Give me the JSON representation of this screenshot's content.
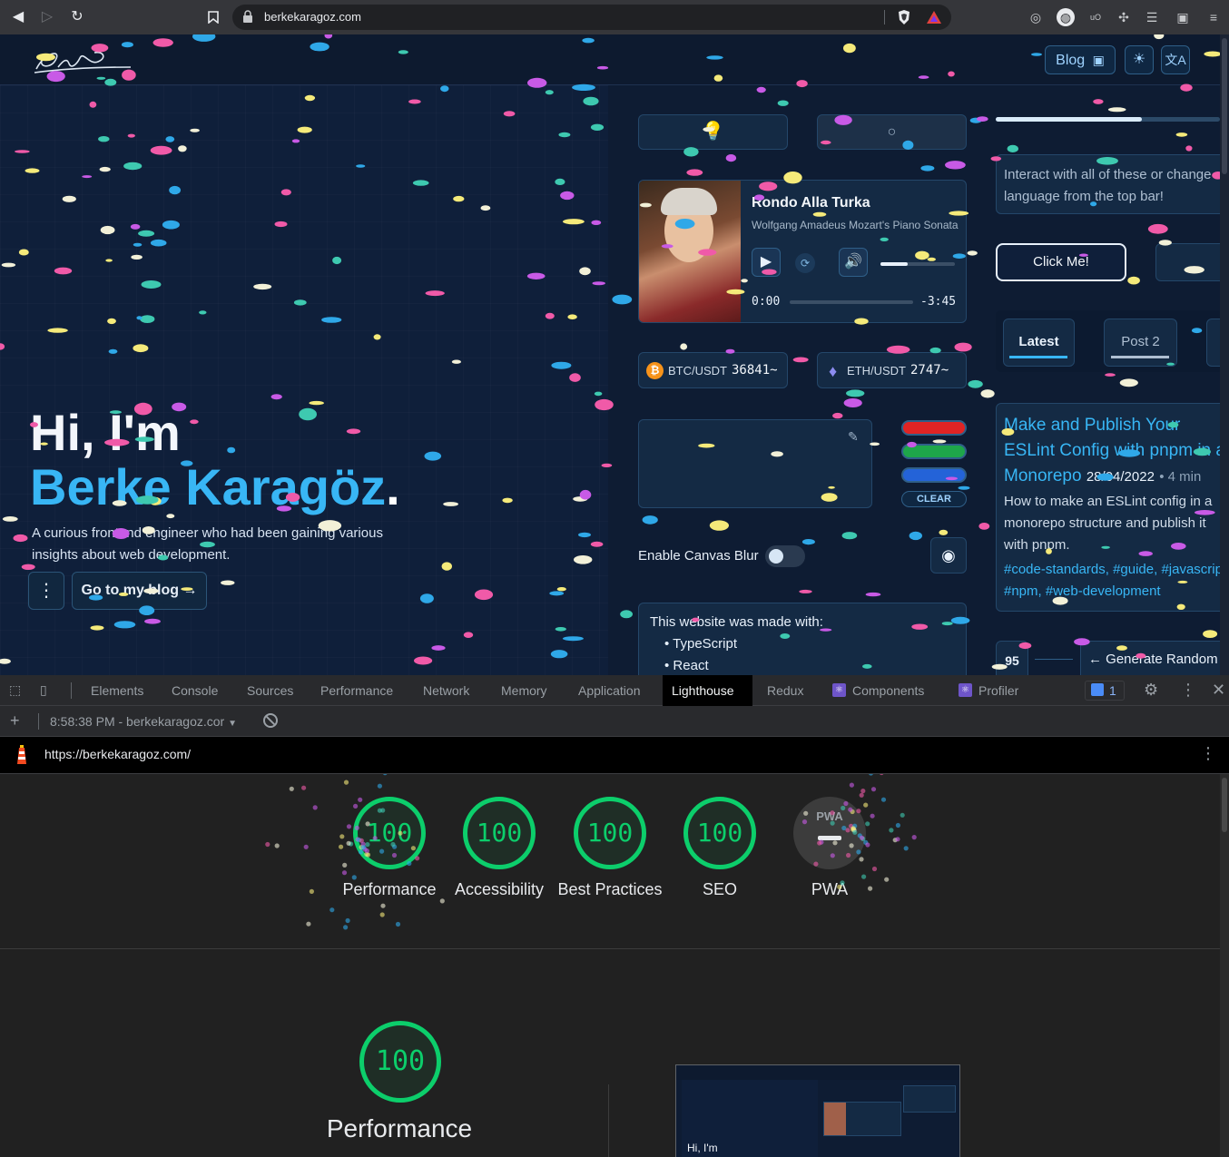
{
  "browser": {
    "url": "berkekaragoz.com",
    "ext_counter": "1"
  },
  "site": {
    "header": {
      "blog_label": "Blog"
    },
    "hero": {
      "greeting": "Hi, I'm",
      "name": "Berke Karagöz",
      "name_dot": ".",
      "subtitle": "A curious frontend engineer who had been gaining various insights about web development.",
      "blog_button": "Go to my blog →"
    },
    "player": {
      "title": "Rondo Alla Turka",
      "artist": "Wolfgang Amadeus Mozart's Piano Sonata",
      "current_time": "0:00",
      "remaining_time": "-3:45"
    },
    "tickers": [
      {
        "pair": "BTC/USDT",
        "price": "36841~"
      },
      {
        "pair": "ETH/USDT",
        "price": "2747~"
      }
    ],
    "canvas": {
      "clear_label": "CLEAR",
      "blur_label": "Enable Canvas Blur"
    },
    "made_with": {
      "heading": "This website was made with:",
      "items": [
        "TypeScript",
        "React"
      ]
    },
    "side": {
      "info_text": "Interact with all of these or change language from the top bar!",
      "click_me": "Click Me!",
      "tabs": [
        "Latest",
        "Post 2"
      ],
      "post": {
        "title": "Make and Publish Your ESLint Config with pnpm in a Monorepo",
        "date": "28/04/2022",
        "read_time": "• 4 min",
        "excerpt": "How to make an ESLint config in a monorepo structure and publish it with pnpm.",
        "tags_line1": "#code-standards, #guide, #javascript,",
        "tags_line2": "#npm, #web-development"
      },
      "counter": "95",
      "generate_label": "← Generate Random"
    },
    "colors": {
      "accent": "#38b6f5",
      "background": "#0e1c33"
    }
  },
  "devtools": {
    "tabs": [
      "Elements",
      "Console",
      "Sources",
      "Performance",
      "Network",
      "Memory",
      "Application",
      "Lighthouse",
      "Redux",
      "Components",
      "Profiler"
    ],
    "active_tab": "Lighthouse",
    "issues_count": "1",
    "report_selector": "8:58:38 PM - berkekaragoz.cor",
    "report_url": "https://berkekaragoz.com/",
    "scores": [
      {
        "label": "Performance",
        "value": "100"
      },
      {
        "label": "Accessibility",
        "value": "100"
      },
      {
        "label": "Best Practices",
        "value": "100"
      },
      {
        "label": "SEO",
        "value": "100"
      },
      {
        "label": "PWA",
        "value": ""
      }
    ],
    "pwa_badge": "PWA",
    "big_score": {
      "value": "100",
      "label": "Performance"
    },
    "thumbnail_text": "Hi, I'm",
    "score_color": "#0cce6b"
  }
}
